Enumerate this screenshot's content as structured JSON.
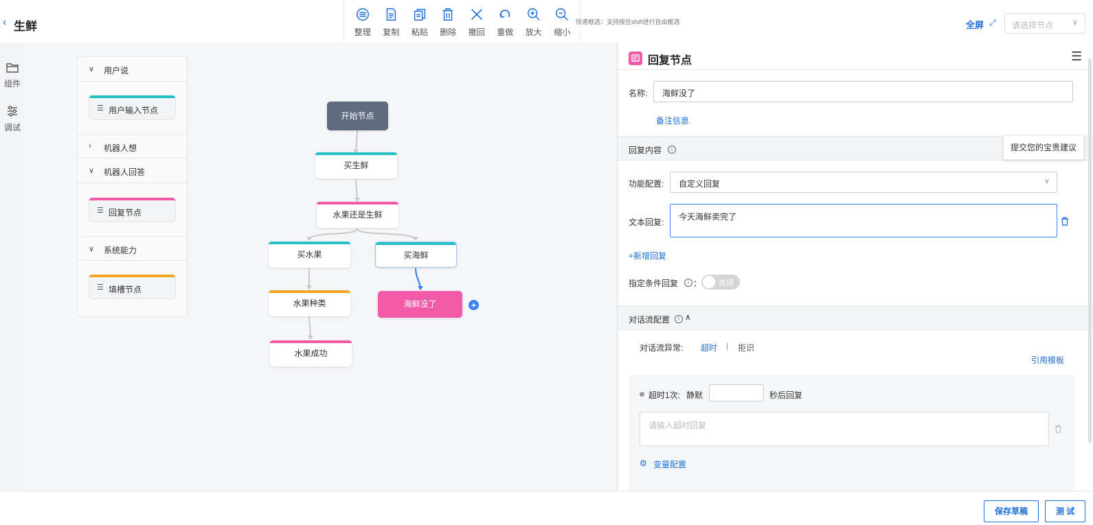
{
  "header": {
    "back_icon": "‹",
    "title": "生鲜",
    "tools": [
      {
        "icon": "organize-icon",
        "label": "整理"
      },
      {
        "icon": "copy-icon",
        "label": "复制"
      },
      {
        "icon": "paste-icon",
        "label": "粘贴"
      },
      {
        "icon": "trash-icon",
        "label": "删除"
      },
      {
        "icon": "close-x-icon",
        "label": "撤回"
      },
      {
        "icon": "redo-icon",
        "label": "重做"
      },
      {
        "icon": "zoom-in-icon",
        "label": "放大"
      },
      {
        "icon": "zoom-out-icon",
        "label": "缩小"
      }
    ],
    "hint": "快速框选：支持按住shift进行自由框选",
    "fullscreen_label": "全屏",
    "node_select_placeholder": "请选择节点"
  },
  "rail": {
    "items": [
      {
        "icon": "folder-icon",
        "label": "组件"
      },
      {
        "icon": "sliders-icon",
        "label": "调试"
      }
    ]
  },
  "palette": {
    "groups": [
      {
        "title": "用户说",
        "expanded": true,
        "item": "用户输入节点",
        "color": "#28c0c8"
      },
      {
        "title": "机器人想",
        "expanded": false
      },
      {
        "title": "机器人回答",
        "expanded": true,
        "item": "回复节点",
        "color": "#f25aa8"
      },
      {
        "title": "系统能力",
        "expanded": true,
        "item": "填槽节点",
        "color": "#f5a623"
      }
    ]
  },
  "flow": {
    "start": "开始节点",
    "buy_fresh": "买生鲜",
    "fruit_or_fresh": "水果还是生鲜",
    "buy_fruit": "买水果",
    "buy_seafood": "买海鲜",
    "fruit_kind": "水果种类",
    "seafood_gone": "海鲜没了",
    "fruit_success": "水果成功",
    "colors": {
      "cyan": "#28c0c8",
      "pink": "#f25aa8",
      "orange": "#f5a623",
      "start": "#5f6b7e"
    }
  },
  "panel": {
    "title": "回复节点",
    "name_label": "名称:",
    "name_value": "海鲜没了",
    "note_link": "备注信息",
    "reply_content_label": "回复内容",
    "func_label": "功能配置:",
    "func_value": "自定义回复",
    "text_label": "文本回复:",
    "text_value": "今天海鲜卖完了",
    "add_reply": "+新增回复",
    "cond_label": "指定条件回复",
    "cond_colon": "：",
    "toggle_label": "关闭",
    "flow_config_label": "对话流配置",
    "exception_label": "对话流异常:",
    "tab_timeout": "超时",
    "tab_sep": "|",
    "tab_reject": "拒识",
    "template_link": "引用模板",
    "timeout_prefix": "超时1次:",
    "silent_label": "静默",
    "seconds_reply": "秒后回复",
    "timeout_placeholder": "请输入超时回复",
    "var_config": "变量配置"
  },
  "tooltip": "提交您的宝贵建议",
  "footer": {
    "save_draft": "保存草稿",
    "test": "测 试"
  }
}
